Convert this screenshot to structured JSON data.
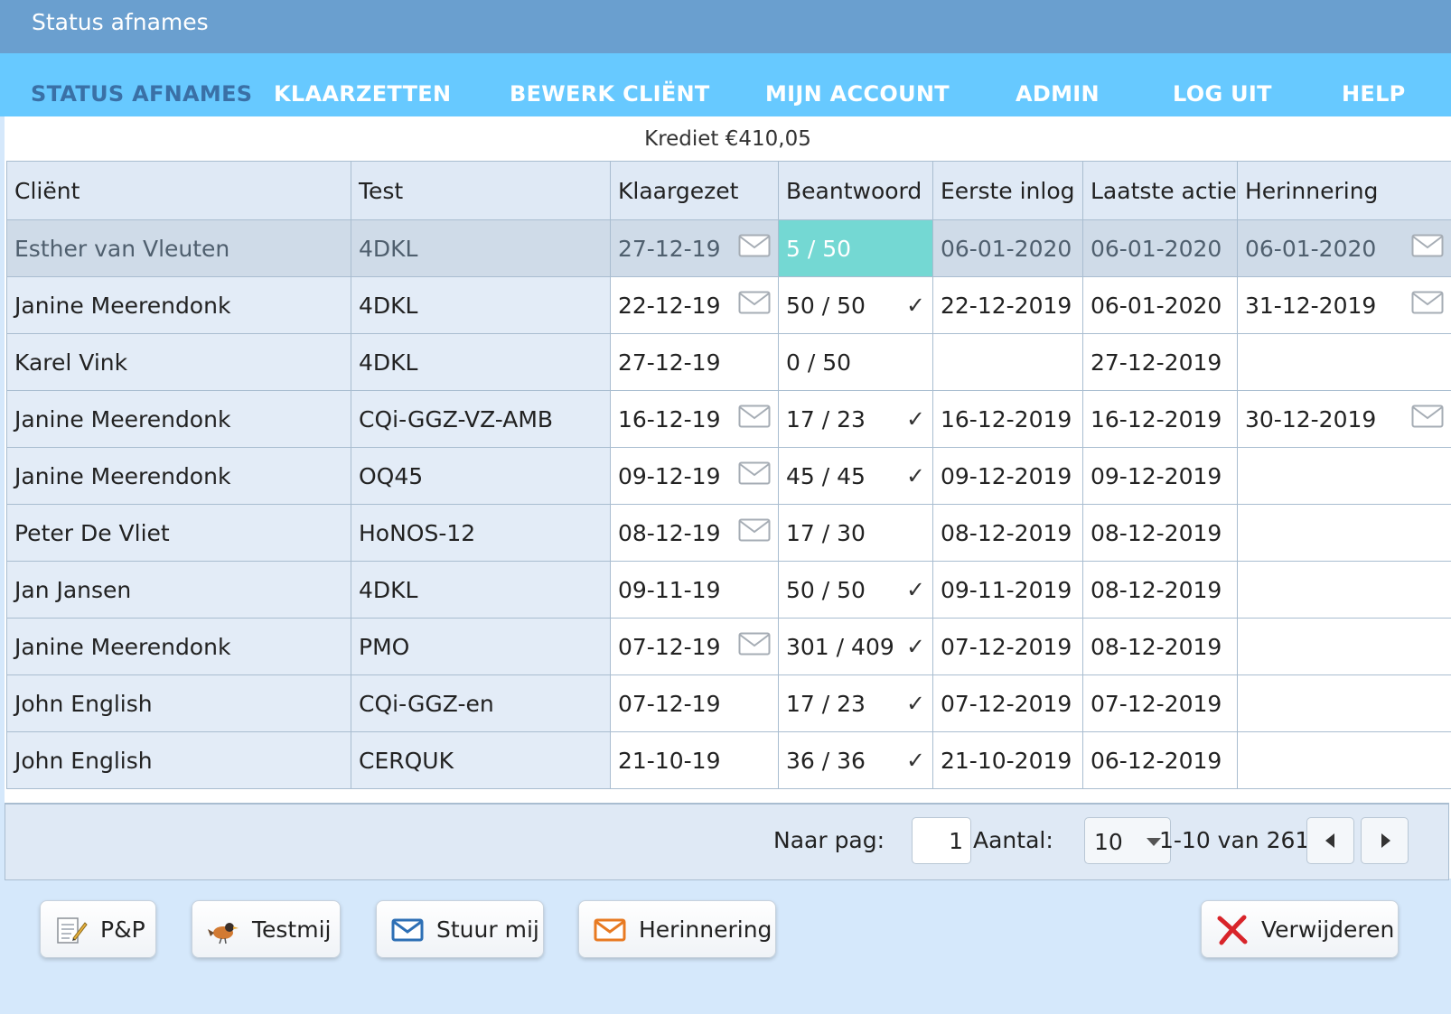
{
  "window": {
    "title": "Status afnames"
  },
  "nav": {
    "items": [
      {
        "label": "STATUS AFNAMES",
        "active": true
      },
      {
        "label": "KLAARZETTEN"
      },
      {
        "label": "BEWERK CLIËNT"
      },
      {
        "label": "MIJN ACCOUNT"
      },
      {
        "label": "ADMIN"
      },
      {
        "label": "LOG UIT"
      },
      {
        "label": "HELP"
      }
    ]
  },
  "credit": "Krediet €410,05",
  "table": {
    "headers": [
      "Cliënt",
      "Test",
      "Klaargezet",
      "Beantwoord",
      "Eerste inlog",
      "Laatste actie",
      "Herinnering"
    ],
    "rows": [
      {
        "client": "Esther van Vleuten",
        "test": "4DKL",
        "ready": "27-12-19",
        "mail": true,
        "answered": "5 / 50",
        "done": false,
        "first_login": "06-01-2020",
        "last_action": "06-01-2020",
        "reminder": "06-01-2020",
        "reminder_mail": true,
        "selected": true
      },
      {
        "client": "Janine Meerendonk",
        "test": "4DKL",
        "ready": "22-12-19",
        "mail": true,
        "answered": "50 / 50",
        "done": true,
        "first_login": "22-12-2019",
        "last_action": "06-01-2020",
        "reminder": "31-12-2019",
        "reminder_mail": true
      },
      {
        "client": "Karel Vink",
        "test": "4DKL",
        "ready": "27-12-19",
        "mail": false,
        "answered": "0 / 50",
        "done": false,
        "first_login": "",
        "last_action": "27-12-2019",
        "reminder": "",
        "reminder_mail": false
      },
      {
        "client": "Janine Meerendonk",
        "test": "CQi-GGZ-VZ-AMB",
        "ready": "16-12-19",
        "mail": true,
        "answered": "17 / 23",
        "done": true,
        "first_login": "16-12-2019",
        "last_action": "16-12-2019",
        "reminder": "30-12-2019",
        "reminder_mail": true
      },
      {
        "client": "Janine Meerendonk",
        "test": "OQ45",
        "ready": "09-12-19",
        "mail": true,
        "answered": "45 / 45",
        "done": true,
        "first_login": "09-12-2019",
        "last_action": "09-12-2019",
        "reminder": "",
        "reminder_mail": false
      },
      {
        "client": "Peter De Vliet",
        "test": "HoNOS-12",
        "ready": "08-12-19",
        "mail": true,
        "answered": "17 / 30",
        "done": false,
        "first_login": "08-12-2019",
        "last_action": "08-12-2019",
        "reminder": "",
        "reminder_mail": false
      },
      {
        "client": "Jan Jansen",
        "test": "4DKL",
        "ready": "09-11-19",
        "mail": false,
        "answered": "50 / 50",
        "done": true,
        "first_login": "09-11-2019",
        "last_action": "08-12-2019",
        "reminder": "",
        "reminder_mail": false
      },
      {
        "client": "Janine Meerendonk",
        "test": "PMO",
        "ready": "07-12-19",
        "mail": true,
        "answered": "301 / 409",
        "done": true,
        "first_login": "07-12-2019",
        "last_action": "08-12-2019",
        "reminder": "",
        "reminder_mail": false
      },
      {
        "client": "John English",
        "test": "CQi-GGZ-en",
        "ready": "07-12-19",
        "mail": false,
        "answered": "17 / 23",
        "done": true,
        "first_login": "07-12-2019",
        "last_action": "07-12-2019",
        "reminder": "",
        "reminder_mail": false
      },
      {
        "client": "John English",
        "test": "CERQUK",
        "ready": "21-10-19",
        "mail": false,
        "answered": "36 / 36",
        "done": true,
        "first_login": "21-10-2019",
        "last_action": "06-12-2019",
        "reminder": "",
        "reminder_mail": false
      }
    ]
  },
  "pager": {
    "goto_label": "Naar pag:",
    "page": "1",
    "count_label": "Aantal:",
    "count": "10",
    "range": "1-10 van 261"
  },
  "actions": {
    "pp": "P&P",
    "testmij": "Testmij",
    "stuur_mij": "Stuur mij",
    "herinnering": "Herinnering",
    "verwijderen": "Verwijderen"
  },
  "icons": {
    "mail": "envelope-icon",
    "done": "check-icon",
    "prev": "triangle-left-icon",
    "next": "triangle-right-icon"
  },
  "colors": {
    "titlebar": "#6a9fcf",
    "navbar": "#67c9ff",
    "nav_active": "#3a70a6",
    "progress_highlight": "#74d8d3",
    "background": "#d5e8fb"
  }
}
